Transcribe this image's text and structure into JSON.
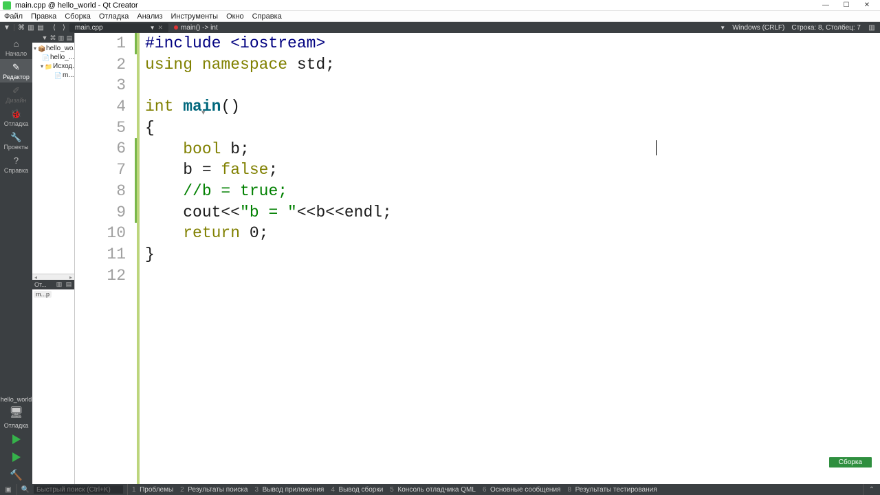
{
  "window": {
    "title": "main.cpp @ hello_world - Qt Creator"
  },
  "menu": [
    "Файл",
    "Правка",
    "Сборка",
    "Отладка",
    "Анализ",
    "Инструменты",
    "Окно",
    "Справка"
  ],
  "tabs": {
    "file": "main.cpp",
    "crumb": "main() -> int"
  },
  "status_top": {
    "encoding": "Windows (CRLF)",
    "pos": "Строка: 8, Столбец: 7"
  },
  "modes": [
    {
      "label": "Начало",
      "icon": "⌂"
    },
    {
      "label": "Редактор",
      "icon": "✎",
      "active": true
    },
    {
      "label": "Дизайн",
      "icon": "✐",
      "dim": true
    },
    {
      "label": "Отладка",
      "icon": "🐞"
    },
    {
      "label": "Проекты",
      "icon": "🔧"
    },
    {
      "label": "Справка",
      "icon": "?"
    }
  ],
  "kit": {
    "name": "hello_world",
    "config": "Отладка"
  },
  "tree": [
    {
      "lvl": 0,
      "tw": "▾",
      "ico": "proj",
      "label": "hello_wo..."
    },
    {
      "lvl": 1,
      "tw": "",
      "ico": "file",
      "label": "hello_..."
    },
    {
      "lvl": 1,
      "tw": "▾",
      "ico": "folder",
      "label": "Исход..."
    },
    {
      "lvl": 2,
      "tw": "",
      "ico": "file",
      "label": "m..."
    }
  ],
  "open_docs_hdr": "От...",
  "open_docs_item": "m...p",
  "code": {
    "lines": [
      {
        "n": 1,
        "mod": true,
        "html": "<span class='pp'>#include</span> <span class='pp'>&lt;iostream&gt;</span>"
      },
      {
        "n": 2,
        "mod": false,
        "html": "<span class='kw'>using</span> <span class='kw'>namespace</span> std;"
      },
      {
        "n": 3,
        "mod": false,
        "html": ""
      },
      {
        "n": 4,
        "mod": false,
        "html": "<span class='kw'>int</span> <span class='fn'>main</span>()"
      },
      {
        "n": 5,
        "mod": false,
        "html": "{"
      },
      {
        "n": 6,
        "mod": true,
        "html": "    <span class='kw'>bool</span> b;"
      },
      {
        "n": 7,
        "mod": true,
        "html": "    b = <span class='kw'>false</span>;"
      },
      {
        "n": 8,
        "mod": true,
        "html": "    <span class='com'>//b = true;</span>"
      },
      {
        "n": 9,
        "mod": true,
        "html": "    cout&lt;&lt;<span class='str'>\"b = \"</span>&lt;&lt;b&lt;&lt;endl;"
      },
      {
        "n": 10,
        "mod": false,
        "html": "    <span class='kw'>return</span> 0;"
      },
      {
        "n": 11,
        "mod": false,
        "html": "}"
      },
      {
        "n": 12,
        "mod": false,
        "html": ""
      }
    ]
  },
  "build_badge": "Сборка",
  "search_placeholder": "Быстрый поиск (Ctrl+K)",
  "bottom_panes": [
    {
      "n": "1",
      "label": "Проблемы"
    },
    {
      "n": "2",
      "label": "Результаты поиска"
    },
    {
      "n": "3",
      "label": "Вывод приложения"
    },
    {
      "n": "4",
      "label": "Вывод сборки"
    },
    {
      "n": "5",
      "label": "Консоль отладчика QML"
    },
    {
      "n": "6",
      "label": "Основные сообщения"
    },
    {
      "n": "8",
      "label": "Результаты тестирования"
    }
  ]
}
